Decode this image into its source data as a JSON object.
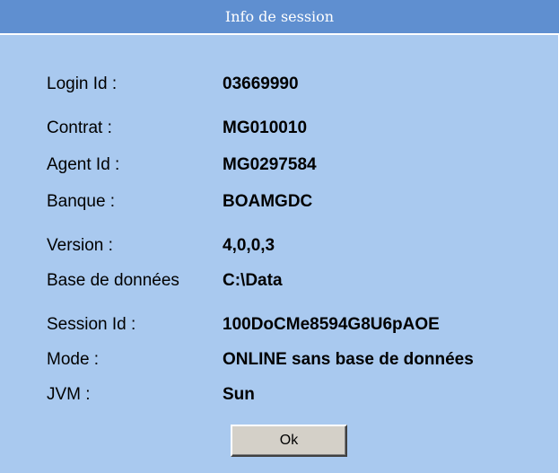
{
  "dialog": {
    "title": "Info de session"
  },
  "fields": [
    {
      "label": "Login Id :",
      "value": "03669990"
    },
    {
      "label": "Contrat :",
      "value": "MG010010"
    },
    {
      "label": "Agent Id :",
      "value": "MG0297584"
    },
    {
      "label": "Banque :",
      "value": "BOAMGDC"
    },
    {
      "label": "Version :",
      "value": "4,0,0,3"
    },
    {
      "label": "Base de données",
      "value": "C:\\Data"
    },
    {
      "label": "Session Id :",
      "value": "100DoCMe8594G8U6pAOE"
    },
    {
      "label": "Mode :",
      "value": "ONLINE sans base de données"
    },
    {
      "label": "JVM :",
      "value": "Sun"
    }
  ],
  "buttons": {
    "ok_label": "Ok"
  },
  "colors": {
    "titlebar": "#5f8fd0",
    "background": "#a9c9ef",
    "button": "#d4d0c8"
  }
}
